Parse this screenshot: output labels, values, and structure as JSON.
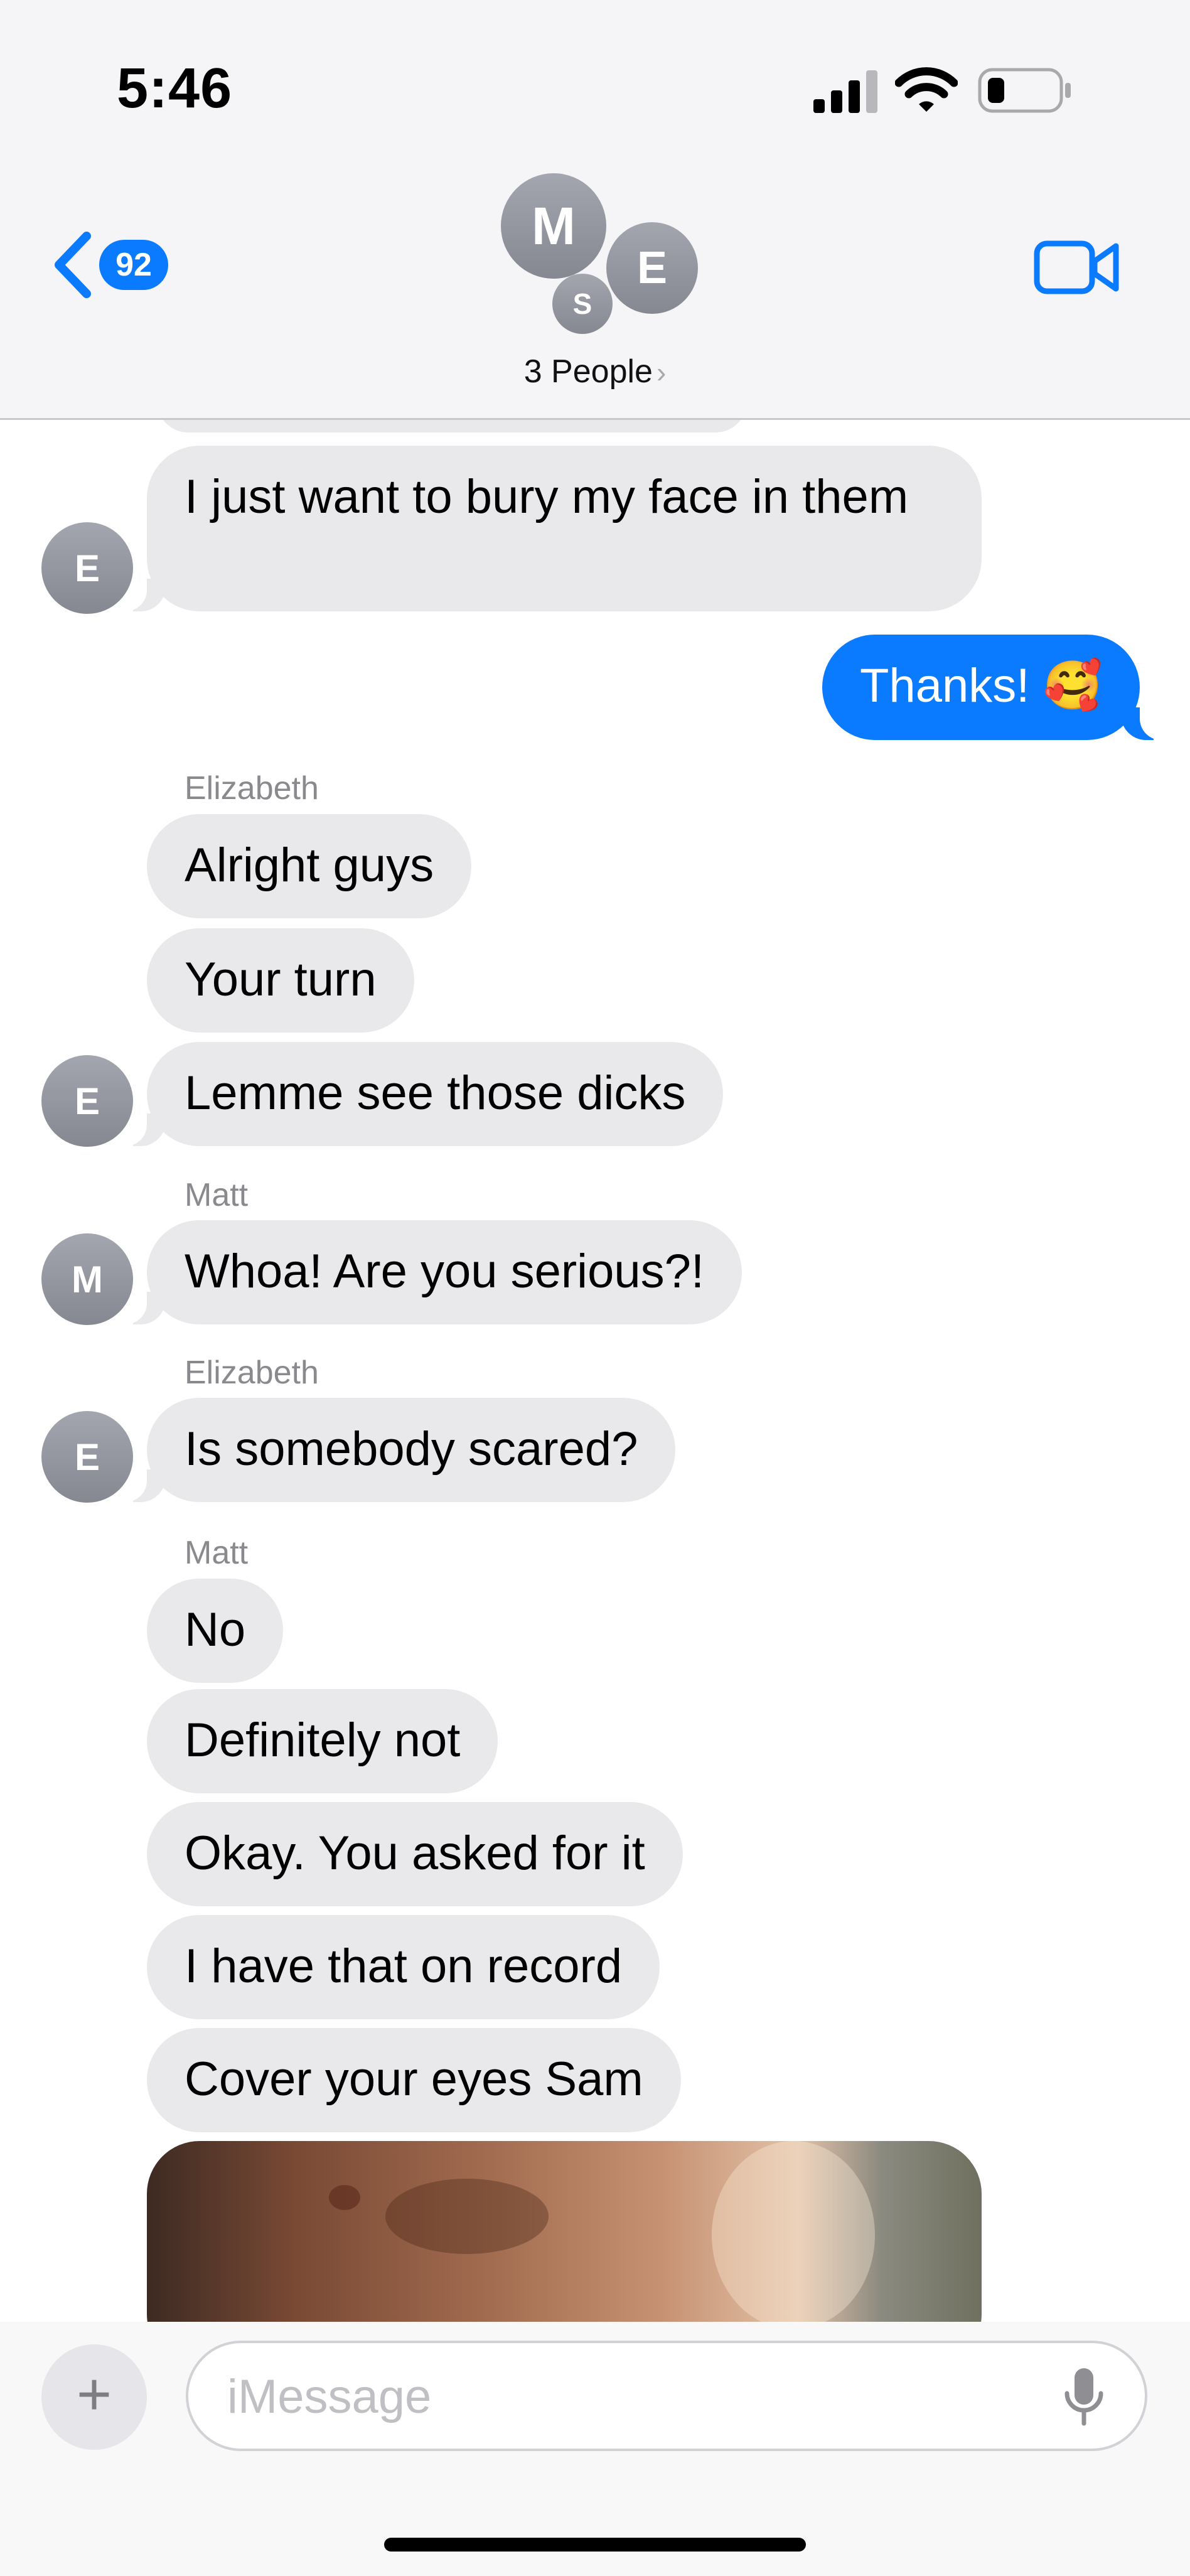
{
  "status_bar": {
    "time": "5:46"
  },
  "header": {
    "back_badge": "92",
    "group_initials": [
      "M",
      "E",
      "S"
    ],
    "group_name": "3 People",
    "chevron": "›"
  },
  "messages": [
    {
      "kind": "in",
      "text": "I just want to bury my face in them",
      "avatar": "E"
    },
    {
      "kind": "out",
      "text": "Thanks! 🥰"
    },
    {
      "kind": "sender",
      "text": "Elizabeth"
    },
    {
      "kind": "in",
      "text": "Alright guys"
    },
    {
      "kind": "in",
      "text": "Your turn"
    },
    {
      "kind": "in",
      "text": "Lemme see those dicks",
      "avatar": "E"
    },
    {
      "kind": "sender",
      "text": "Matt"
    },
    {
      "kind": "in",
      "text": "Whoa! Are you serious?!",
      "avatar": "M"
    },
    {
      "kind": "sender",
      "text": "Elizabeth"
    },
    {
      "kind": "in",
      "text": "Is somebody scared?",
      "avatar": "E"
    },
    {
      "kind": "sender",
      "text": "Matt"
    },
    {
      "kind": "in",
      "text": "No"
    },
    {
      "kind": "in",
      "text": "Definitely not"
    },
    {
      "kind": "in",
      "text": "Okay. You asked for it"
    },
    {
      "kind": "in",
      "text": "I have that on record"
    },
    {
      "kind": "in",
      "text": "Cover your eyes Sam"
    },
    {
      "kind": "photo"
    }
  ],
  "input": {
    "placeholder": "iMessage",
    "value": "",
    "plus_label": "+"
  },
  "icons": {
    "back": "chevron-left-icon",
    "video": "video-camera-icon",
    "mic": "microphone-icon",
    "signal": "cellular-signal-icon",
    "wifi": "wifi-icon",
    "battery": "battery-icon"
  },
  "colors": {
    "accent": "#0a7aff",
    "incoming_bubble": "#e9e9eb",
    "avatar_gray": "#9a9da5"
  }
}
